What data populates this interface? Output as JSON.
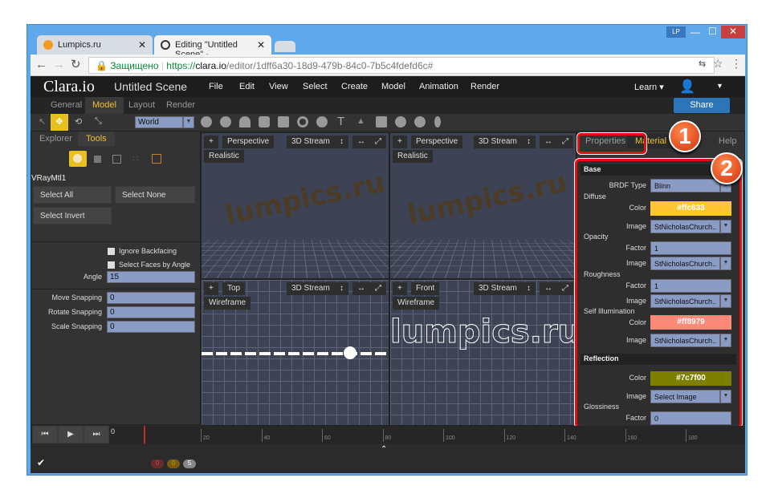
{
  "browser": {
    "tabs": [
      {
        "label": "Lumpics.ru"
      },
      {
        "label": "Editing \"Untitled Scene\" -"
      }
    ],
    "secure_label": "Защищено",
    "url_scheme": "https://",
    "url_host": "clara.io",
    "url_path": "/editor/1dff6a30-18d9-479b-84c0-7b5c4fdefd6c#",
    "profile": "LP"
  },
  "app": {
    "logo": "Clara.io",
    "scene_title": "Untitled Scene",
    "menu": [
      "File",
      "Edit",
      "View",
      "Select",
      "Create",
      "Model",
      "Animation",
      "Render"
    ],
    "learn": "Learn ▾",
    "share": "Share",
    "subtabs": [
      "General",
      "Model",
      "Layout",
      "Render"
    ],
    "active_subtab": "Model",
    "coord_space": "World"
  },
  "left_panel": {
    "tabs": [
      "Explorer",
      "Tools"
    ],
    "active": "Tools",
    "material": "VRayMtl1",
    "select_all": "Select All",
    "select_none": "Select None",
    "select_invert": "Select Invert",
    "ignore_backfacing": "Ignore Backfacing",
    "select_faces_by_angle": "Select Faces by Angle",
    "angle_label": "Angle",
    "angle": "15",
    "move_snapping_label": "Move Snapping",
    "move_snapping": "0",
    "rotate_snapping_label": "Rotate Snapping",
    "rotate_snapping": "0",
    "scale_snapping_label": "Scale Snapping",
    "scale_snapping": "0"
  },
  "viewports": [
    {
      "view": "Perspective",
      "stream": "3D Stream",
      "mode": "Realistic"
    },
    {
      "view": "Perspective",
      "stream": "3D Stream",
      "mode": "Realistic"
    },
    {
      "view": "Top",
      "stream": "3D Stream",
      "mode": "Wireframe"
    },
    {
      "view": "Front",
      "stream": "3D Stream",
      "mode": "Wireframe"
    }
  ],
  "scene_text": "lumpics.ru",
  "right_panel": {
    "tabs": [
      "Properties",
      "Material",
      "y",
      "Help"
    ],
    "active": "Material",
    "base": {
      "title": "Base",
      "brdf_label": "BRDF Type",
      "brdf": "Blinn",
      "diffuse": "Diffuse",
      "color_label": "Color",
      "diffuse_color": "#ffc633",
      "image_label": "Image",
      "image_value": "StNicholasChurch..",
      "opacity": "Opacity",
      "factor_label": "Factor",
      "opacity_factor": "1",
      "roughness": "Roughness",
      "roughness_factor": "1",
      "self_illum": "Self Illumination",
      "self_illum_color": "#ff8979"
    },
    "reflection": {
      "title": "Reflection",
      "color_label": "Color",
      "color": "#7c7f00",
      "image_label": "Image",
      "image": "Select Image",
      "glossiness": "Glossiness",
      "factor_label": "Factor",
      "factor": "0"
    }
  },
  "timeline": {
    "current": "0",
    "ticks": [
      "20",
      "40",
      "60",
      "80",
      "100",
      "120",
      "140",
      "160",
      "180"
    ],
    "counts": [
      "0",
      "0",
      "5"
    ]
  },
  "annotations": [
    "1",
    "2"
  ],
  "colors": {
    "accent": "#f0c030",
    "highlight": "#e01010"
  }
}
